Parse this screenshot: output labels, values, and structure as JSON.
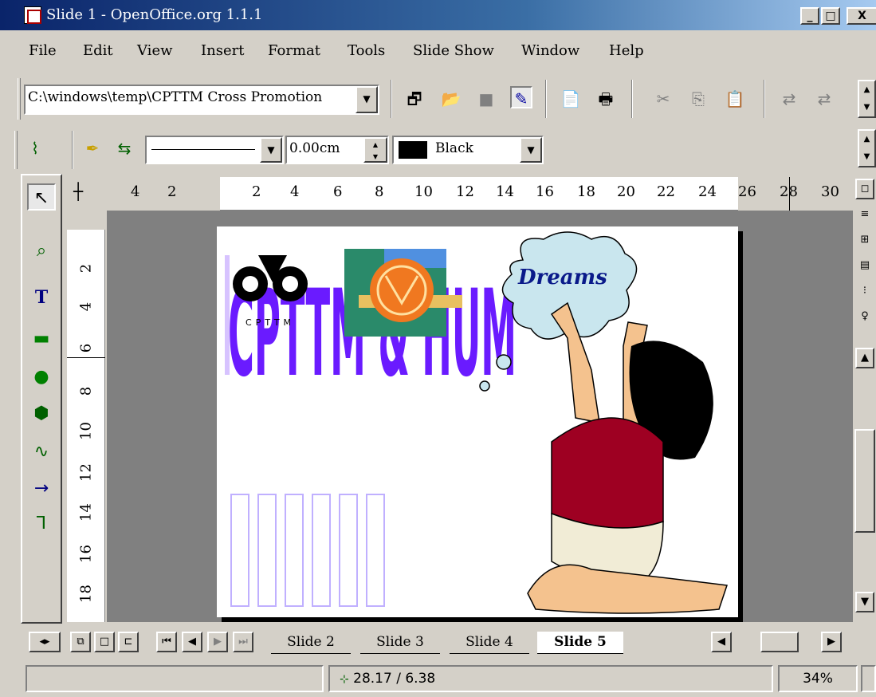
{
  "window": {
    "title": "Slide 1 - OpenOffice.org 1.1.1"
  },
  "menu": [
    "File",
    "Edit",
    "View",
    "Insert",
    "Format",
    "Tools",
    "Slide Show",
    "Window",
    "Help"
  ],
  "toolbar": {
    "document_path": "C:\\windows\\temp\\CPTTM Cross Promotion",
    "line_width": "0.00cm",
    "line_color": "Black"
  },
  "ruler": {
    "h_ticks": [
      "4",
      "2",
      "2",
      "4",
      "6",
      "8",
      "10",
      "12",
      "14",
      "16",
      "18",
      "20",
      "22",
      "24",
      "26",
      "28",
      "30"
    ],
    "v_ticks": [
      "2",
      "4",
      "6",
      "8",
      "10",
      "12",
      "14",
      "16",
      "18"
    ]
  },
  "slide": {
    "logo_text": "CPTTM",
    "banner_text": "CPTTM & HUM",
    "bubble_text": "Dreams"
  },
  "tabs": [
    "Slide 2",
    "Slide 3",
    "Slide 4",
    "Slide 5"
  ],
  "status": {
    "position": "28.17 / 6.38",
    "zoom": "34%"
  }
}
